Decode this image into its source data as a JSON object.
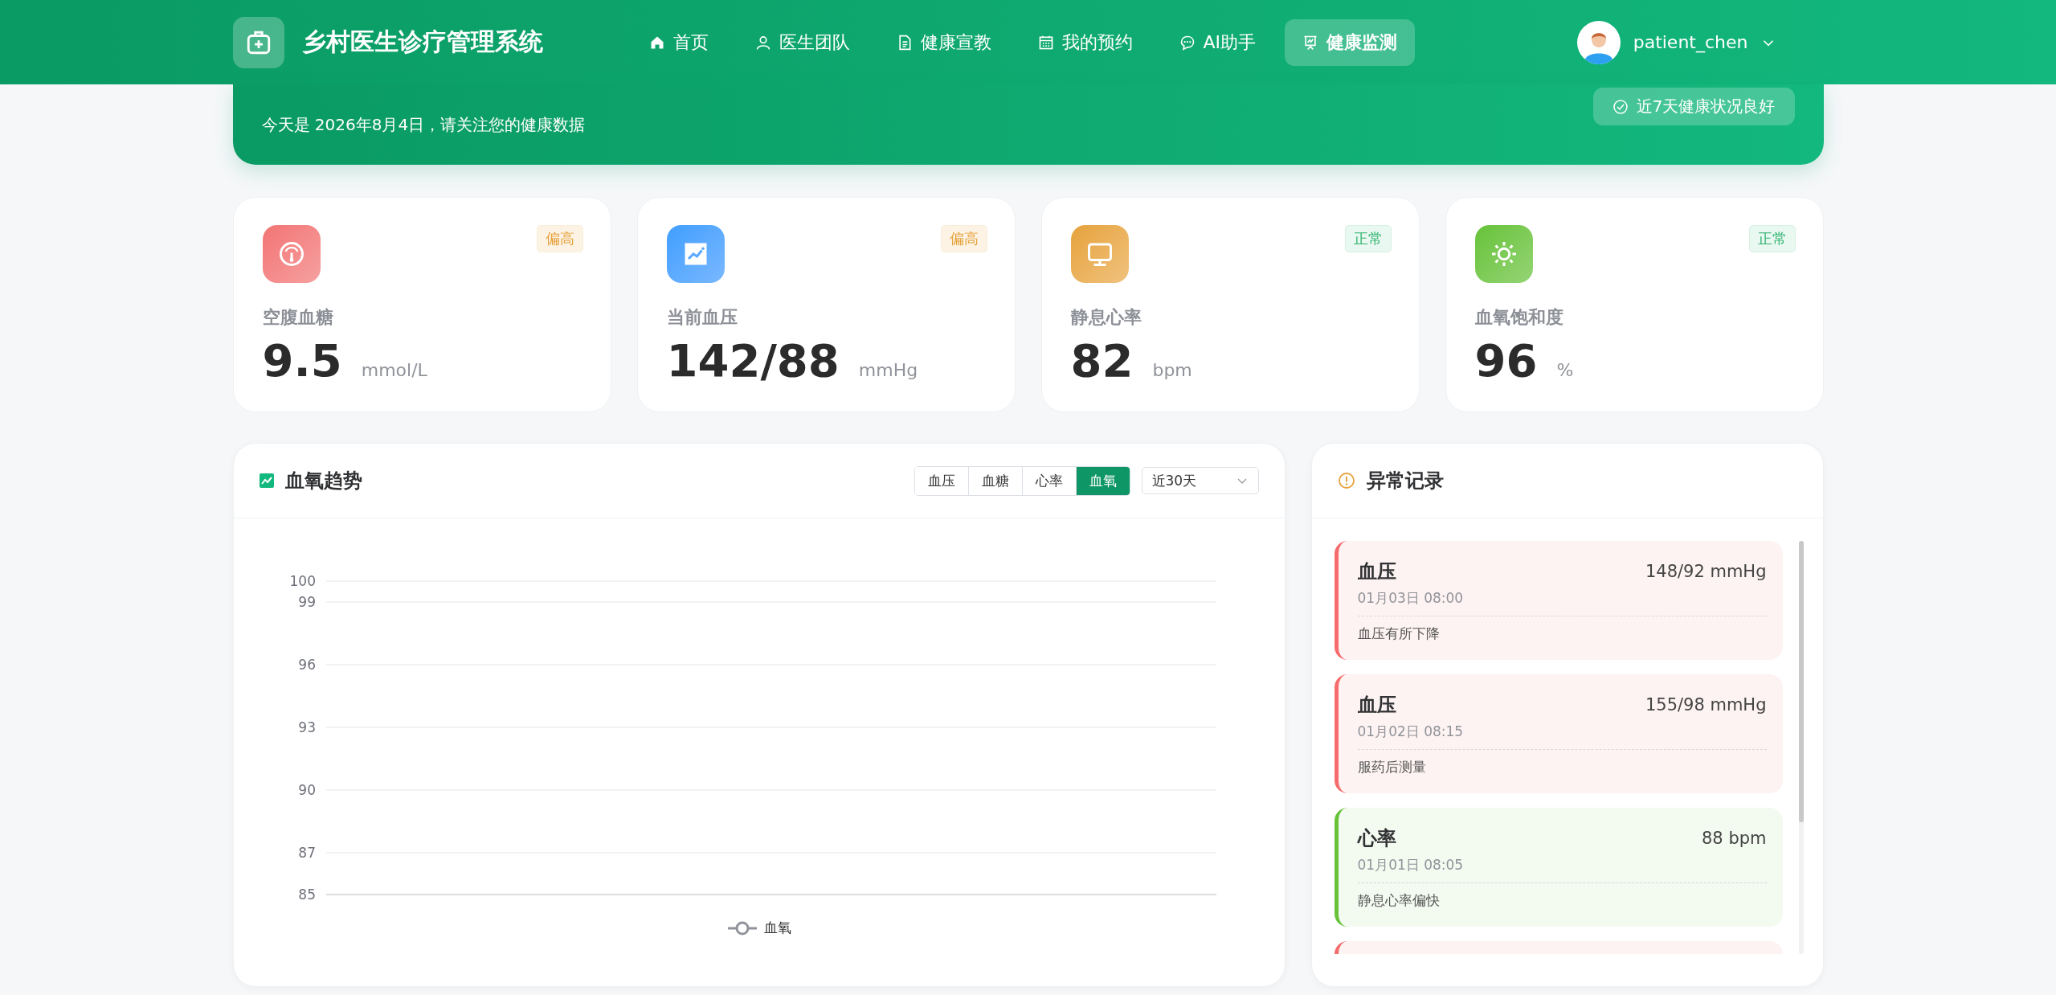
{
  "header": {
    "title": "乡村医生诊疗管理系统",
    "nav": [
      {
        "label": "首页",
        "selected": false
      },
      {
        "label": "医生团队",
        "selected": false
      },
      {
        "label": "健康宣教",
        "selected": false
      },
      {
        "label": "我的预约",
        "selected": false
      },
      {
        "label": "AI助手",
        "selected": false
      },
      {
        "label": "健康监测",
        "selected": true
      }
    ],
    "user": {
      "name": "patient_chen"
    }
  },
  "banner": {
    "subtitle": "今天是 2026年8月4日，请关注您的健康数据",
    "badge": "近7天健康状况良好"
  },
  "metrics": [
    {
      "label": "空腹血糖",
      "value": "9.5",
      "unit": "mmol/L",
      "status": {
        "kind": "high",
        "text": "偏高"
      }
    },
    {
      "label": "当前血压",
      "value": "142/88",
      "unit": "mmHg",
      "status": {
        "kind": "high",
        "text": "偏高"
      }
    },
    {
      "label": "静息心率",
      "value": "82",
      "unit": "bpm",
      "status": {
        "kind": "normal",
        "text": "正常"
      }
    },
    {
      "label": "血氧饱和度",
      "value": "96",
      "unit": "%",
      "status": {
        "kind": "normal",
        "text": "正常"
      }
    }
  ],
  "trend": {
    "title": "血氧趋势",
    "types": [
      {
        "label": "血压",
        "selected": false
      },
      {
        "label": "血糖",
        "selected": false
      },
      {
        "label": "心率",
        "selected": false
      },
      {
        "label": "血氧",
        "selected": true
      }
    ],
    "range": "近30天",
    "chart_data": {
      "type": "line",
      "grid": true,
      "ylim": [
        85,
        100
      ],
      "yticks": [
        85,
        87,
        90,
        93,
        96,
        99,
        100
      ],
      "series": [
        {
          "name": "血氧",
          "color": "#909399"
        }
      ]
    }
  },
  "abnormal": {
    "title": "异常记录",
    "records": [
      {
        "type": "血压",
        "value": "148/92 mmHg",
        "time": "01月03日 08:00",
        "note": "血压有所下降",
        "color": "#f56c6c"
      },
      {
        "type": "血压",
        "value": "155/98 mmHg",
        "time": "01月02日 08:15",
        "note": "服药后测量",
        "color": "#f56c6c"
      },
      {
        "type": "心率",
        "value": "88 bpm",
        "time": "01月01日 08:05",
        "note": "静息心率偏快",
        "color": "#67c23a"
      },
      {
        "color": "#f56c6c"
      }
    ]
  }
}
